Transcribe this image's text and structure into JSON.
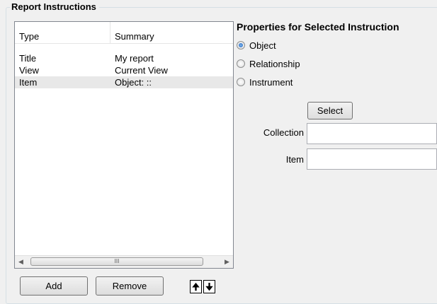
{
  "report_instructions": {
    "title": "Report Instructions",
    "columns": [
      "Type",
      "Summary"
    ],
    "rows": [
      {
        "type": "Title",
        "summary": "My report",
        "selected": false
      },
      {
        "type": "View",
        "summary": "Current View",
        "selected": false
      },
      {
        "type": "Item",
        "summary": "Object: ::",
        "selected": true
      }
    ],
    "scroll_thumb_grip": "III",
    "add_label": "Add",
    "remove_label": "Remove",
    "move_up_glyph": "🠉",
    "move_down_glyph": "🠋"
  },
  "properties": {
    "title": "Properties for Selected Instruction",
    "options": [
      {
        "label": "Object",
        "checked": true
      },
      {
        "label": "Relationship",
        "checked": false
      },
      {
        "label": "Instrument",
        "checked": false
      }
    ],
    "select_label": "Select",
    "collection_label": "Collection",
    "collection_value": "",
    "item_label": "Item",
    "item_value": ""
  }
}
